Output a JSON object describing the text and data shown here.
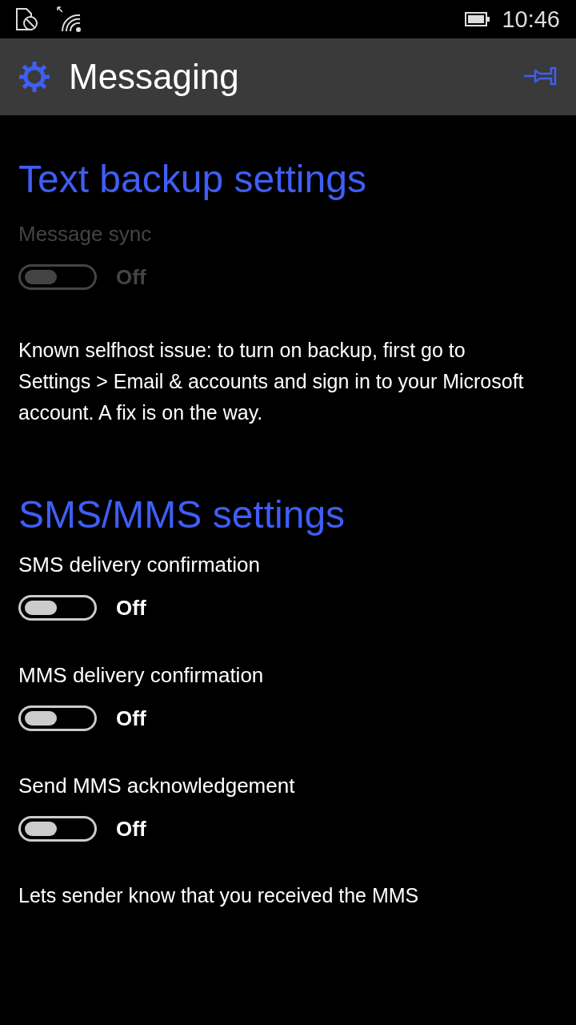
{
  "status_bar": {
    "time": "10:46"
  },
  "header": {
    "title": "Messaging"
  },
  "sections": [
    {
      "title": "Text backup settings",
      "items": [
        {
          "kind": "toggle",
          "label": "Message sync",
          "on": false,
          "disabled": true,
          "state": "Off"
        },
        {
          "kind": "note",
          "text": "Known selfhost issue: to turn on backup, first go to Settings > Email & accounts and sign in to your Microsoft account. A fix is on the way."
        }
      ]
    },
    {
      "title": "SMS/MMS settings",
      "items": [
        {
          "kind": "toggle",
          "label": "SMS delivery confirmation",
          "on": false,
          "disabled": false,
          "state": "Off"
        },
        {
          "kind": "toggle",
          "label": "MMS delivery confirmation",
          "on": false,
          "disabled": false,
          "state": "Off"
        },
        {
          "kind": "toggle",
          "label": "Send MMS acknowledgement",
          "on": false,
          "disabled": false,
          "state": "Off"
        },
        {
          "kind": "note",
          "text": "Lets sender know that you received the MMS"
        }
      ]
    }
  ]
}
